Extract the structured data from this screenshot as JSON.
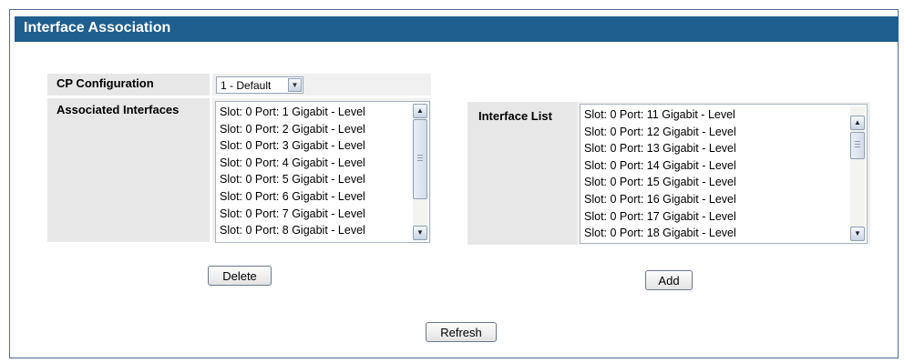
{
  "panel": {
    "title": "Interface Association"
  },
  "cp_configuration": {
    "label": "CP Configuration",
    "selected": "1 - Default"
  },
  "associated_interfaces": {
    "label": "Associated Interfaces",
    "items": [
      "Slot: 0 Port: 1 Gigabit - Level",
      "Slot: 0 Port: 2 Gigabit - Level",
      "Slot: 0 Port: 3 Gigabit - Level",
      "Slot: 0 Port: 4 Gigabit - Level",
      "Slot: 0 Port: 5 Gigabit - Level",
      "Slot: 0 Port: 6 Gigabit - Level",
      "Slot: 0 Port: 7 Gigabit - Level",
      "Slot: 0 Port: 8 Gigabit - Level"
    ]
  },
  "interface_list": {
    "label": "Interface List",
    "items": [
      "Slot: 0 Port: 11 Gigabit - Level",
      "Slot: 0 Port: 12 Gigabit - Level",
      "Slot: 0 Port: 13 Gigabit - Level",
      "Slot: 0 Port: 14 Gigabit - Level",
      "Slot: 0 Port: 15 Gigabit - Level",
      "Slot: 0 Port: 16 Gigabit - Level",
      "Slot: 0 Port: 17 Gigabit - Level",
      "Slot: 0 Port: 18 Gigabit - Level"
    ]
  },
  "buttons": {
    "delete": "Delete",
    "add": "Add",
    "refresh": "Refresh"
  },
  "icons": {
    "dropdown": "chevron-down-icon",
    "scroll_up": "chevron-up-icon",
    "scroll_down": "chevron-down-icon"
  },
  "colors": {
    "title_bar": "#1f5f8f",
    "panel_border": "#4c6f95",
    "label_cell": "#e7e7e7",
    "value_cell": "#f0f0f0"
  }
}
